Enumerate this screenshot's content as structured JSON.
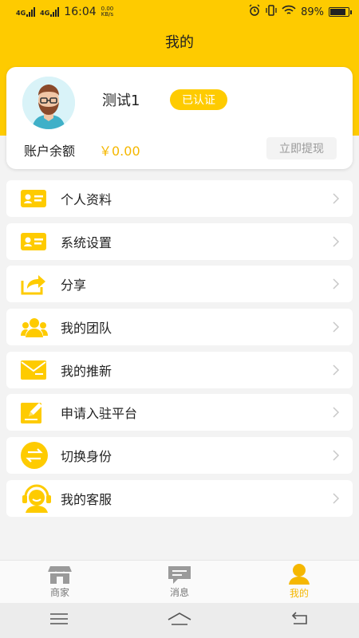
{
  "status_bar": {
    "network_1": "4G",
    "network_2": "4G",
    "time": "16:04",
    "speed_value": "0.00",
    "speed_unit": "KB/s",
    "battery_level": "89%"
  },
  "header": {
    "title": "我的"
  },
  "profile": {
    "name": "测试1",
    "badge": "已认证",
    "balance_label": "账户余额",
    "balance_value": "￥0.00",
    "withdraw_label": "立即提现"
  },
  "menu": [
    {
      "label": "个人资料",
      "icon": "id-card-icon"
    },
    {
      "label": "系统设置",
      "icon": "id-card-icon"
    },
    {
      "label": "分享",
      "icon": "share-icon"
    },
    {
      "label": "我的团队",
      "icon": "team-icon"
    },
    {
      "label": "我的推新",
      "icon": "envelope-icon"
    },
    {
      "label": "申请入驻平台",
      "icon": "edit-icon"
    },
    {
      "label": "切换身份",
      "icon": "switch-icon"
    },
    {
      "label": "我的客服",
      "icon": "customer-service-icon"
    }
  ],
  "tabs": [
    {
      "label": "商家",
      "icon": "store-icon",
      "active": false
    },
    {
      "label": "消息",
      "icon": "message-icon",
      "active": false
    },
    {
      "label": "我的",
      "icon": "user-icon",
      "active": true
    }
  ],
  "colors": {
    "accent": "#fecb00",
    "accent_text": "#f5b700"
  }
}
